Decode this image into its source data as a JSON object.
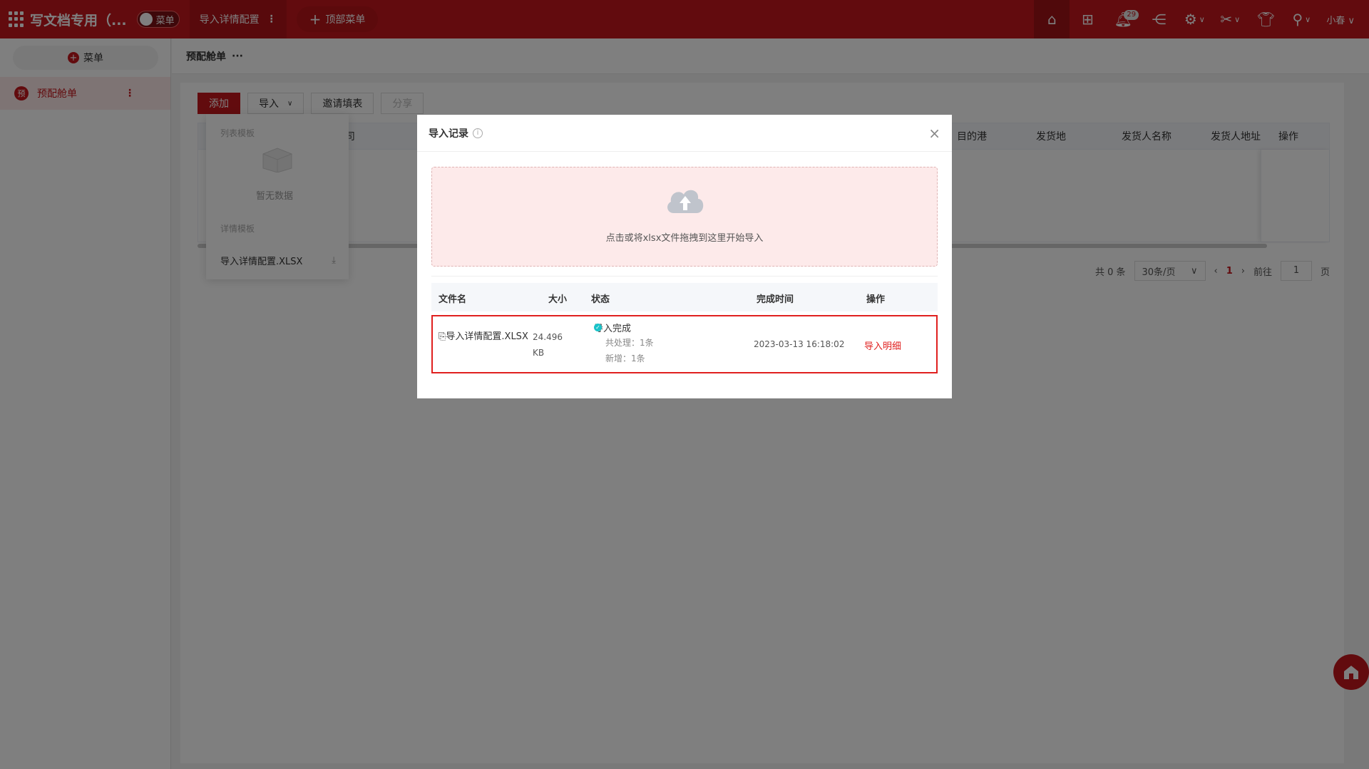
{
  "topbar": {
    "app_title": "写文档专用（...",
    "toggle_label": "菜单",
    "tab_label": "导入详情配置",
    "top_menu_label": "顶部菜单",
    "notification_count": "29",
    "user_name": "小春"
  },
  "sidebar": {
    "menu_button": "菜单",
    "items": [
      {
        "avatar": "预",
        "label": "预配舱单"
      }
    ]
  },
  "breadcrumb": {
    "title": "预配舱单"
  },
  "toolbar": {
    "add": "添加",
    "import": "导入",
    "invite": "邀请填表",
    "share": "分享"
  },
  "table": {
    "headers_visible": [
      "司",
      "目的港",
      "发货地",
      "发货人名称",
      "发货人地址",
      "操作"
    ]
  },
  "pager": {
    "total": "共 0 条",
    "page_size": "30条/页",
    "current_page": "1",
    "goto_label": "前往",
    "goto_value": "1",
    "page_suffix": "页"
  },
  "import_dropdown": {
    "list_template_label": "列表模板",
    "empty_text": "暂无数据",
    "detail_template_label": "详情模板",
    "file_name": "导入详情配置.XLSX"
  },
  "modal": {
    "title": "导入记录",
    "upload_text": "点击或将xlsx文件拖拽到这里开始导入",
    "columns": {
      "file_name": "文件名",
      "size": "大小",
      "status": "状态",
      "finish_time": "完成时间",
      "action": "操作"
    },
    "records": [
      {
        "file_name": "导入详情配置.XLSX",
        "size_value": "24.496",
        "size_unit": "KB",
        "status": "导入完成",
        "processed": "共处理：1条",
        "added": "新增：1条",
        "finish_time": "2023-03-13 16:18:02",
        "action": "导入明细"
      }
    ]
  },
  "colors": {
    "brand": "#c4171d",
    "highlight_border": "#e0201f",
    "status_ok": "#19c3c9"
  }
}
